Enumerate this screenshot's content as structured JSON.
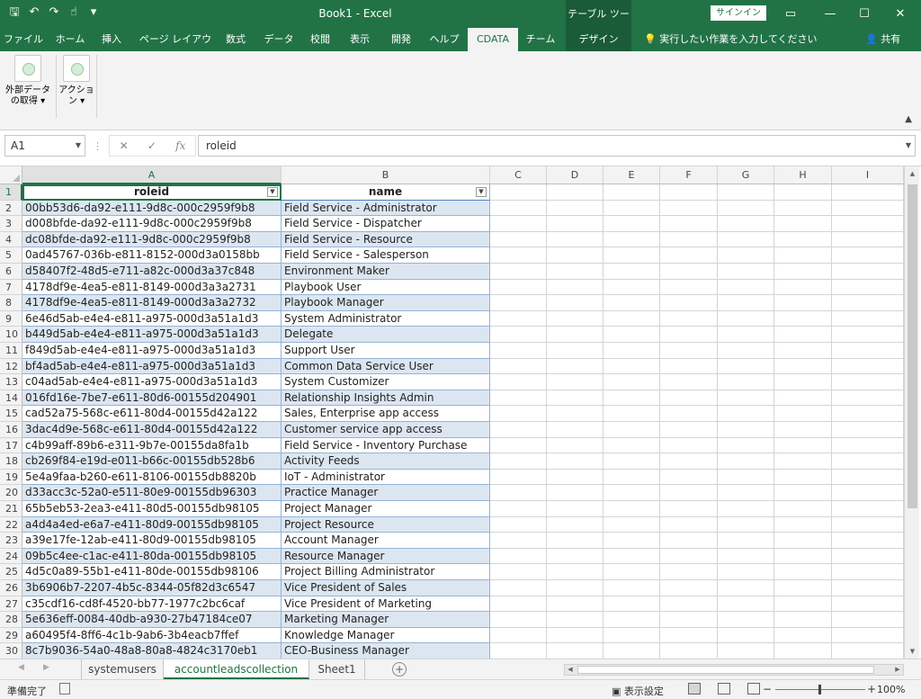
{
  "window": {
    "title": "Book1  -  Excel",
    "table_tools": "テーブル ツール",
    "signin": "サインイン",
    "qat_undo_symbol": "↶",
    "qat_redo_symbol": "↷"
  },
  "tabs": [
    {
      "label": "ファイル"
    },
    {
      "label": "ホーム"
    },
    {
      "label": "挿入"
    },
    {
      "label": "ページ レイアウト"
    },
    {
      "label": "数式"
    },
    {
      "label": "データ"
    },
    {
      "label": "校閲"
    },
    {
      "label": "表示"
    },
    {
      "label": "開発"
    },
    {
      "label": "ヘルプ"
    },
    {
      "label": "CDATA"
    },
    {
      "label": "チーム"
    },
    {
      "label": "デザイン"
    }
  ],
  "tell_me": "実行したい作業を入力してください",
  "share": "共有",
  "ribbon": {
    "external_data_line1": "外部データ",
    "external_data_line2": "の取得 ▾",
    "action_line1": "アクショ",
    "action_line2": "ン ▾"
  },
  "formula_bar": {
    "name_box": "A1",
    "content": "roleid"
  },
  "columns": [
    "A",
    "B",
    "C",
    "D",
    "E",
    "F",
    "G",
    "H",
    "I"
  ],
  "table": {
    "headers": [
      "roleid",
      "name"
    ],
    "rows": [
      [
        "00bb53d6-da92-e111-9d8c-000c2959f9b8",
        "Field Service - Administrator"
      ],
      [
        "d008bfde-da92-e111-9d8c-000c2959f9b8",
        "Field Service - Dispatcher"
      ],
      [
        "dc08bfde-da92-e111-9d8c-000c2959f9b8",
        "Field Service - Resource"
      ],
      [
        "0ad45767-036b-e811-8152-000d3a0158bb",
        "Field Service - Salesperson"
      ],
      [
        "d58407f2-48d5-e711-a82c-000d3a37c848",
        "Environment Maker"
      ],
      [
        "4178df9e-4ea5-e811-8149-000d3a3a2731",
        "Playbook User"
      ],
      [
        "4178df9e-4ea5-e811-8149-000d3a3a2732",
        "Playbook Manager"
      ],
      [
        "6e46d5ab-e4e4-e811-a975-000d3a51a1d3",
        "System Administrator"
      ],
      [
        "b449d5ab-e4e4-e811-a975-000d3a51a1d3",
        "Delegate"
      ],
      [
        "f849d5ab-e4e4-e811-a975-000d3a51a1d3",
        "Support User"
      ],
      [
        "bf4ad5ab-e4e4-e811-a975-000d3a51a1d3",
        "Common Data Service User"
      ],
      [
        "c04ad5ab-e4e4-e811-a975-000d3a51a1d3",
        "System Customizer"
      ],
      [
        "016fd16e-7be7-e611-80d6-00155d204901",
        "Relationship Insights Admin"
      ],
      [
        "cad52a75-568c-e611-80d4-00155d42a122",
        "Sales, Enterprise app access"
      ],
      [
        "3dac4d9e-568c-e611-80d4-00155d42a122",
        "Customer service app access"
      ],
      [
        "c4b99aff-89b6-e311-9b7e-00155da8fa1b",
        "Field Service - Inventory Purchase"
      ],
      [
        "cb269f84-e19d-e011-b66c-00155db528b6",
        "Activity Feeds"
      ],
      [
        "5e4a9faa-b260-e611-8106-00155db8820b",
        "IoT - Administrator"
      ],
      [
        "d33acc3c-52a0-e511-80e9-00155db96303",
        "Practice Manager"
      ],
      [
        "65b5eb53-2ea3-e411-80d5-00155db98105",
        "Project Manager"
      ],
      [
        "a4d4a4ed-e6a7-e411-80d9-00155db98105",
        "Project Resource"
      ],
      [
        "a39e17fe-12ab-e411-80d9-00155db98105",
        "Account Manager"
      ],
      [
        "09b5c4ee-c1ac-e411-80da-00155db98105",
        "Resource Manager"
      ],
      [
        "4d5c0a89-55b1-e411-80de-00155db98106",
        "Project Billing Administrator"
      ],
      [
        "3b6906b7-2207-4b5c-8344-05f82d3c6547",
        "Vice President of Sales"
      ],
      [
        "c35cdf16-cd8f-4520-bb77-1977c2bc6caf",
        "Vice President of Marketing"
      ],
      [
        "5e636eff-0084-40db-a930-27b47184ce07",
        "Marketing Manager"
      ],
      [
        "a60495f4-8ff6-4c1b-9ab6-3b4eacb7ffef",
        "Knowledge Manager"
      ],
      [
        "8c7b9036-54a0-48a8-80a8-4824c3170eb1",
        "CEO-Business Manager"
      ]
    ]
  },
  "sheets": [
    "systemusers",
    "accountleadscollection",
    "Sheet1"
  ],
  "status": {
    "ready": "準備完了",
    "display_settings": "表示設定",
    "zoom": "100%"
  },
  "colors": {
    "accent": "#217346",
    "table_band": "#dce6f1",
    "table_border": "#95b3d7"
  }
}
